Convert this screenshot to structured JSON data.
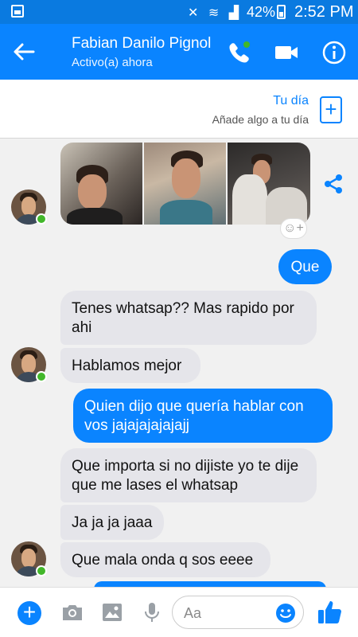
{
  "status_bar": {
    "battery": "42%",
    "time": "2:52 PM"
  },
  "header": {
    "contact_name": "Fabian Danilo Pignol",
    "contact_status": "Activo(a) ahora"
  },
  "day_card": {
    "title": "Tu día",
    "subtitle": "Añade algo a tu día",
    "add_label": "+"
  },
  "messages": [
    {
      "from": "them",
      "text": "Que"
    },
    {
      "from": "them",
      "text": "Tenes whatsap?? Mas rapido por ahi"
    },
    {
      "from": "them",
      "text": "Hablamos mejor"
    },
    {
      "from": "me",
      "text": "Quien dijo que quería hablar con vos jajajajajajajj"
    },
    {
      "from": "them",
      "text": "Que importa si no dijiste yo te dije que me lases el whatsap"
    },
    {
      "from": "them",
      "text": "Ja ja ja jaaa"
    },
    {
      "from": "them",
      "text": "Que mala onda q sos eeee"
    }
  ],
  "composer": {
    "placeholder": "Aa"
  },
  "colors": {
    "accent": "#0a84ff",
    "online": "#42b72a",
    "incoming_bubble": "#e5e5ea"
  }
}
